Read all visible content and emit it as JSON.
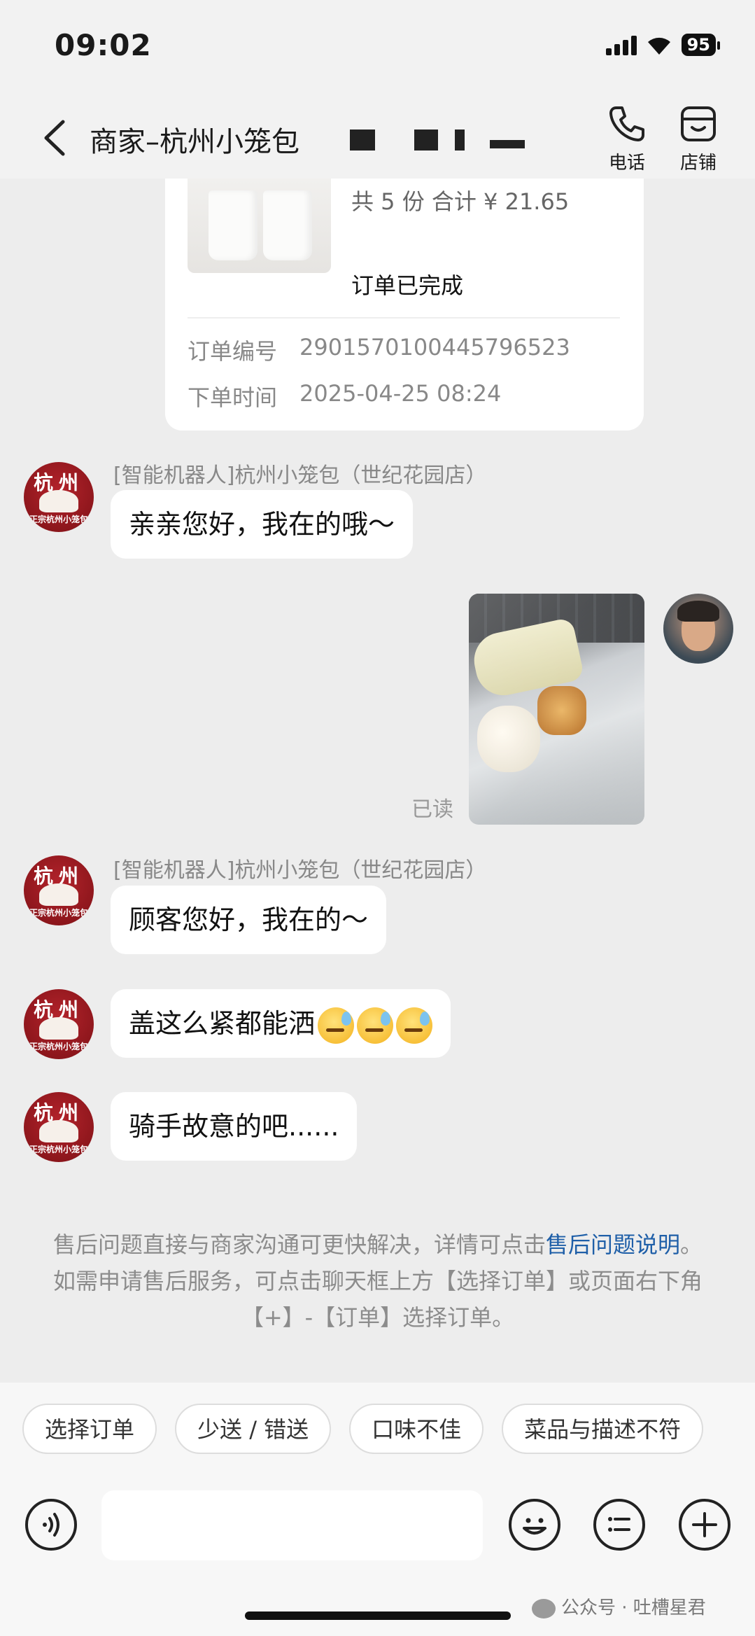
{
  "status_bar": {
    "time": "09:02",
    "battery": "95"
  },
  "header": {
    "title": "商家–杭州小笼包",
    "actions": [
      {
        "label": "电话",
        "icon": "phone-icon"
      },
      {
        "label": "店铺",
        "icon": "store-icon"
      }
    ]
  },
  "order": {
    "summary": "共 5 份 合计 ¥ 21.65",
    "status": "订单已完成",
    "number_label": "订单编号",
    "number_value": "2901570100445796523",
    "time_label": "下单时间",
    "time_value": "2025-04-25 08:24"
  },
  "messages": [
    {
      "sender": "[智能机器人]杭州小笼包（世纪花园店）",
      "text": "亲亲您好，我在的哦～"
    },
    {
      "type": "image",
      "from": "me",
      "read_status": "已读"
    },
    {
      "sender": "[智能机器人]杭州小笼包（世纪花园店）",
      "text": "顾客您好，我在的～"
    },
    {
      "text": "盖这么紧都能洒"
    },
    {
      "text": "骑手故意的吧......"
    }
  ],
  "avatar_text": {
    "line1": "杭州",
    "line2": "正宗杭州小笼包"
  },
  "notice": {
    "part1": "售后问题直接与商家沟通可更快解决，详情可点击",
    "link": "售后问题说明",
    "part2": "。如需申请售后服务，可点击聊天框上方【选择订单】或页面右下角【+】-【订单】选择订单。"
  },
  "quick_replies": [
    "选择订单",
    "少送 / 错送",
    "口味不佳",
    "菜品与描述不符"
  ],
  "input": {
    "placeholder": ""
  },
  "watermark": "公众号 · 吐槽星君",
  "colors": {
    "background": "#ededed",
    "link": "#1f5fa8",
    "avatar_red": "#9b1a20"
  }
}
